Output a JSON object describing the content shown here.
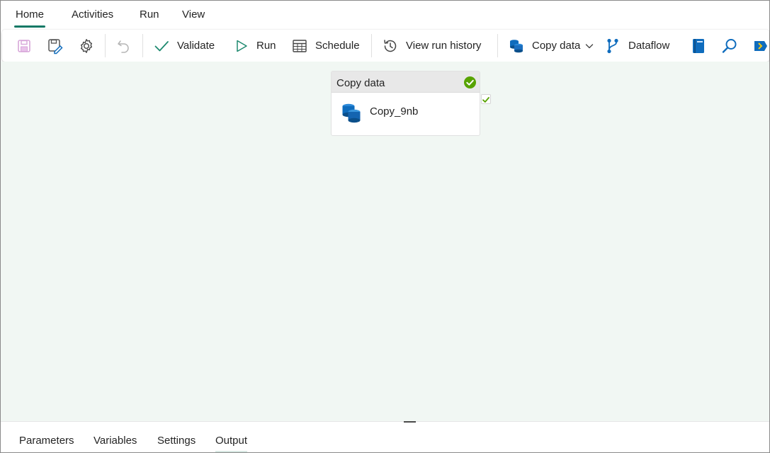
{
  "menu": {
    "tabs": [
      {
        "label": "Home"
      },
      {
        "label": "Activities"
      },
      {
        "label": "Run"
      },
      {
        "label": "View"
      }
    ],
    "active": "Home"
  },
  "ribbon": {
    "icons": [
      "save-icon",
      "save-as-icon",
      "settings-icon",
      "undo-icon"
    ],
    "validate_label": "Validate",
    "run_label": "Run",
    "schedule_label": "Schedule",
    "history_label": "View run history",
    "copy_data_label": "Copy data",
    "dataflow_label": "Dataflow",
    "more_icons": [
      "notebook-icon",
      "lookup-icon",
      "script-icon"
    ]
  },
  "canvas": {
    "activity": {
      "type_label": "Copy data",
      "name": "Copy_9nb",
      "status": "succeeded"
    }
  },
  "bottom_panel": {
    "tabs": [
      {
        "label": "Parameters"
      },
      {
        "label": "Variables"
      },
      {
        "label": "Settings"
      },
      {
        "label": "Output"
      }
    ],
    "active": "Output"
  },
  "colors": {
    "accent": "#117865",
    "canvas_bg": "#f1f7f3",
    "success": "#57a300",
    "ribbon_icon_blue": "#0f6cbd"
  }
}
